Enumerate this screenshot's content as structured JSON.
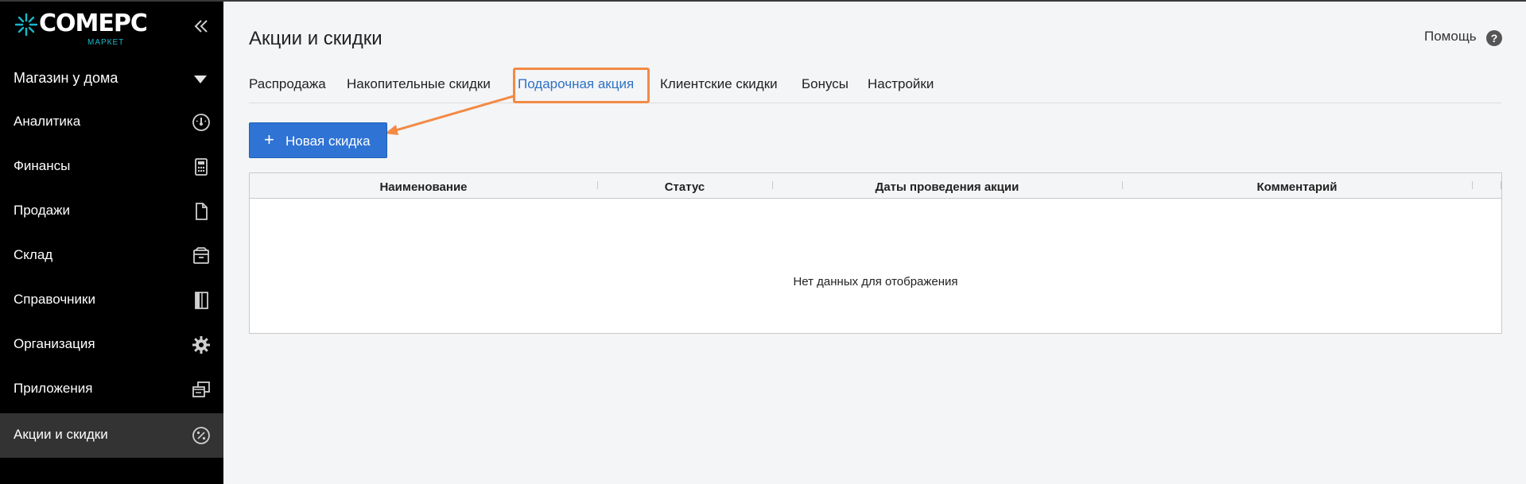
{
  "brand": {
    "name": "COMEPC",
    "subtitle": "МАРКЕТ",
    "accent": "#19b8c8"
  },
  "sidebar": {
    "store": "Магазин у дома",
    "items": [
      {
        "label": "Аналитика",
        "icon": "dashboard-gauge-icon",
        "active": false
      },
      {
        "label": "Финансы",
        "icon": "calculator-icon",
        "active": false
      },
      {
        "label": "Продажи",
        "icon": "document-icon",
        "active": false
      },
      {
        "label": "Склад",
        "icon": "box-icon",
        "active": false
      },
      {
        "label": "Справочники",
        "icon": "book-icon",
        "active": false
      },
      {
        "label": "Организация",
        "icon": "gear-icon",
        "active": false
      },
      {
        "label": "Приложения",
        "icon": "windows-icon",
        "active": false
      },
      {
        "label": "Акции и скидки",
        "icon": "percent-badge-icon",
        "active": true
      }
    ]
  },
  "header": {
    "title": "Акции и скидки",
    "help_label": "Помощь",
    "help_icon_glyph": "?"
  },
  "tabs": [
    {
      "label": "Распродажа",
      "active": false
    },
    {
      "label": "Накопительные скидки",
      "active": false
    },
    {
      "label": "Подарочная акция",
      "active": true
    },
    {
      "label": "Клиентские скидки",
      "active": false
    },
    {
      "label": "Бонусы",
      "active": false
    },
    {
      "label": "Настройки",
      "active": false
    }
  ],
  "toolbar": {
    "new_button_label": "Новая скидка",
    "new_button_icon": "+"
  },
  "grid": {
    "columns": [
      "Наименование",
      "Статус",
      "Даты проведения акции",
      "Комментарий"
    ],
    "empty_message": "Нет данных для отображения"
  },
  "colors": {
    "sidebar_bg": "#000000",
    "active_item_bg": "#333333",
    "primary_button": "#2f73d4",
    "active_tab": "#2f72c4",
    "annotation": "#f28a45"
  }
}
